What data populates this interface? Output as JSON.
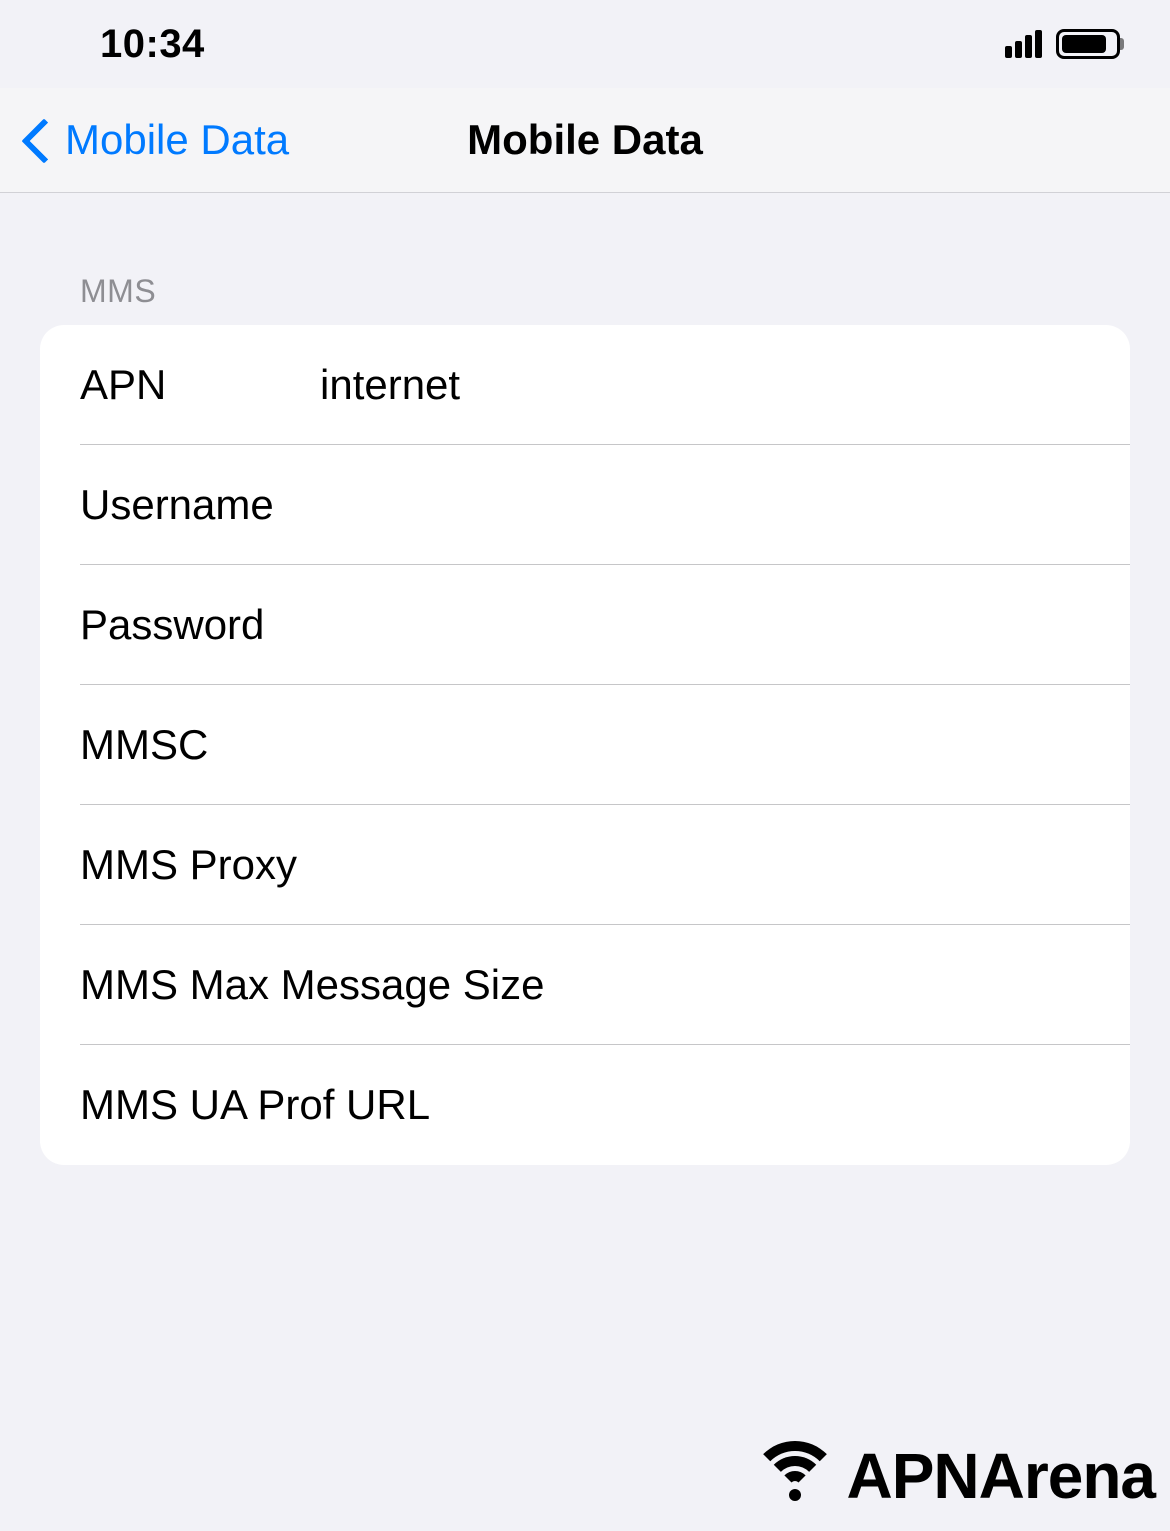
{
  "status_bar": {
    "time": "10:34"
  },
  "nav": {
    "back_label": "Mobile Data",
    "title": "Mobile Data"
  },
  "section": {
    "header": "MMS",
    "rows": [
      {
        "label": "APN",
        "value": "internet"
      },
      {
        "label": "Username",
        "value": ""
      },
      {
        "label": "Password",
        "value": ""
      },
      {
        "label": "MMSC",
        "value": ""
      },
      {
        "label": "MMS Proxy",
        "value": ""
      },
      {
        "label": "MMS Max Message Size",
        "value": ""
      },
      {
        "label": "MMS UA Prof URL",
        "value": ""
      }
    ]
  },
  "watermark": {
    "text_center": "APNArena",
    "text_bottom": "APNArena"
  }
}
